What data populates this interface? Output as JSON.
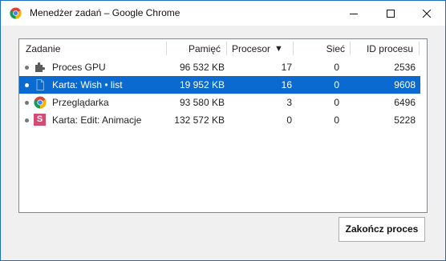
{
  "window": {
    "title": "Menedżer zadań – Google Chrome",
    "controls": {
      "minimize": "minimize-icon",
      "maximize": "maximize-icon",
      "close": "close-icon"
    }
  },
  "table": {
    "columns": [
      {
        "label": "Zadanie"
      },
      {
        "label": "Pamięć"
      },
      {
        "label": "Procesor"
      },
      {
        "label": "Sieć"
      },
      {
        "label": "ID procesu"
      }
    ],
    "sort_indicator": "▼",
    "rows": [
      {
        "task": "Proces GPU",
        "memory": "96 532 KB",
        "cpu": "17",
        "network": "0",
        "pid": "2536",
        "icon": "puzzle-icon",
        "selected": false
      },
      {
        "task": "Karta: Wish • list",
        "memory": "19 952 KB",
        "cpu": "16",
        "network": "0",
        "pid": "9608",
        "icon": "page-icon",
        "selected": true
      },
      {
        "task": "Przeglądarka",
        "memory": "93 580 KB",
        "cpu": "3",
        "network": "0",
        "pid": "6496",
        "icon": "chrome-icon",
        "selected": false
      },
      {
        "task": "Karta: Edit: Animacje",
        "memory": "132 572 KB",
        "cpu": "0",
        "network": "0",
        "pid": "5228",
        "icon": "s-favicon-icon",
        "icon_letter": "S",
        "selected": false
      }
    ]
  },
  "end_process_button": "Zakończ proces",
  "colors": {
    "selection": "#0a6ad0",
    "frame_border": "#1a6fc0",
    "favicon_s": "#d44b72"
  }
}
